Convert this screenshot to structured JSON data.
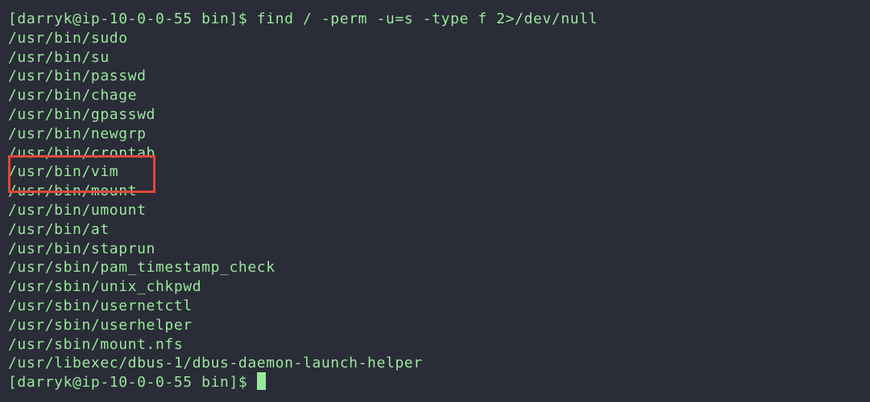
{
  "terminal": {
    "prompt": "[darryk@ip-10-0-0-55 bin]$ ",
    "command": "find / -perm -u=s -type f 2>/dev/null",
    "output": [
      "/usr/bin/sudo",
      "/usr/bin/su",
      "/usr/bin/passwd",
      "/usr/bin/chage",
      "/usr/bin/gpasswd",
      "/usr/bin/newgrp",
      "/usr/bin/crontab",
      "/usr/bin/vim",
      "/usr/bin/mount",
      "/usr/bin/umount",
      "/usr/bin/at",
      "/usr/bin/staprun",
      "/usr/sbin/pam_timestamp_check",
      "/usr/sbin/unix_chkpwd",
      "/usr/sbin/usernetctl",
      "/usr/sbin/userhelper",
      "/usr/sbin/mount.nfs",
      "/usr/libexec/dbus-1/dbus-daemon-launch-helper"
    ],
    "final_prompt": "[darryk@ip-10-0-0-55 bin]$ ",
    "highlighted_entry": "/usr/bin/vim"
  },
  "colors": {
    "background": "#2a2c37",
    "text": "#9ae89d",
    "highlight_border": "#e0483a"
  }
}
